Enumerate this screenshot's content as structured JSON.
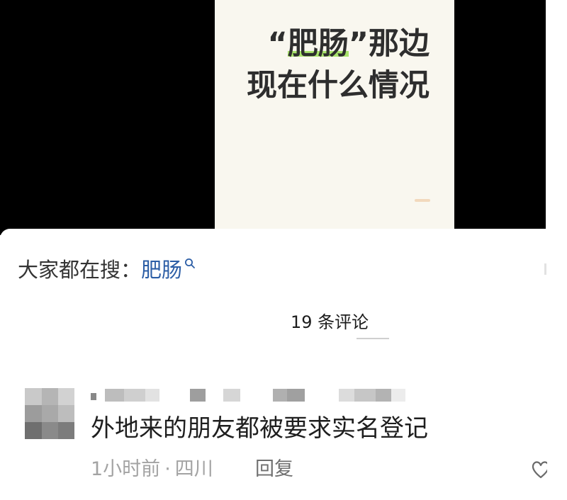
{
  "video_card": {
    "title_open_quote": "“",
    "title_highlight": "肥肠",
    "title_rest": "”那边",
    "title_line2": "现在什么情况"
  },
  "search_suggestion": {
    "label": "大家都在搜：",
    "keyword": "肥肠",
    "icon": "search-icon"
  },
  "comments": {
    "count_label": "19 条评论",
    "items": [
      {
        "text": "外地来的朋友都被要求实名登记",
        "time": "1小时前",
        "separator": "·",
        "location": "四川",
        "reply_label": "回复",
        "like_icon": "heart-icon"
      }
    ]
  },
  "colors": {
    "keyword_blue": "#2c5ea6",
    "highlight_green": "#a8e26c",
    "video_background": "#000000",
    "card_background": "#f9f7ef",
    "meta_gray": "#a3a3a3"
  }
}
